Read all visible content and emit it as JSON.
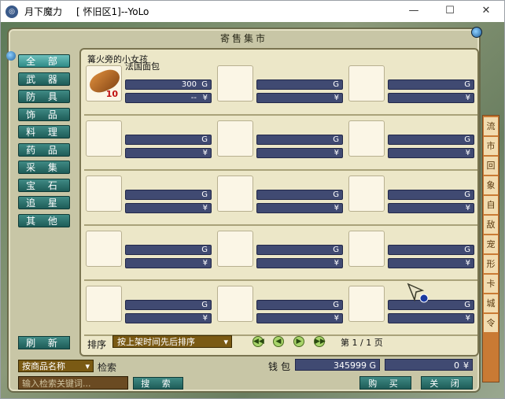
{
  "window": {
    "app_title": "月下魔力",
    "title": "[ 怀旧区1]--YoLo",
    "icon": "app-icon"
  },
  "panel": {
    "title": "寄售集市",
    "close_icon": "close-icon"
  },
  "categories": [
    "全 部",
    "武 器",
    "防 具",
    "饰 品",
    "料 理",
    "药 品",
    "采 集",
    "宝 石",
    "追 星",
    "其 他"
  ],
  "refresh_label": "刷 新",
  "listing": {
    "seller": "篝火旁的小女孩",
    "item_name": "法国面包",
    "item_icon": "bread-icon",
    "price_gold": "300",
    "price_yuan": "--",
    "qty": "10",
    "gold_unit": "G",
    "yuan_unit": "¥"
  },
  "right_strip": [
    "流",
    "市",
    "回",
    "象",
    "自",
    "敌",
    "宠",
    "形",
    "卡",
    "城",
    "令"
  ],
  "sort": {
    "label": "排序",
    "selected": "按上架时间先后排序"
  },
  "pagination": {
    "text": "第 1 / 1 页"
  },
  "search": {
    "type": "按商品名称",
    "label": "检索",
    "placeholder": "输入检索关键词...",
    "button": "搜 索"
  },
  "wallet": {
    "label": "钱包",
    "gold": "345999",
    "yuan": "0"
  },
  "buttons": {
    "buy": "购 买",
    "close": "关 闭"
  }
}
